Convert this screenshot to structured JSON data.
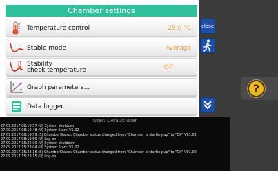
{
  "header": {
    "title": "Chamber settings"
  },
  "menu": [
    {
      "label": "Temperature control",
      "value": "25.0 °C"
    },
    {
      "label": "Stable mode",
      "value": "Average"
    },
    {
      "label_line1": "Stability",
      "label_line2": "check temperature",
      "value": "Off"
    },
    {
      "label": "Graph parameters..."
    },
    {
      "label": "Data logger..."
    }
  ],
  "side": {
    "close_label": "close"
  },
  "log": {
    "title": "User: Default user",
    "lines": [
      "27.09.2017 08:18:57 (U) System shutdown",
      "27.09.2017 08:19:48 (U) System Start: V1.02",
      "27.09.2017 08:19:59 (S) ChamberStatus: Chamber status changed from \"Chamber is starting up\" to \"Ok\" V01.02",
      "27.09.2017 08:19:59 (U) Log-on",
      "27.09.2017 15:22:00 (U) System shutdown",
      "27.09.2017 15:23:04 (U) System Start: V1.02",
      "27.09.2017 15:23:15 (S) ChamberStatus: Chamber status changed from \"Chamber is starting up\" to \"Ok\" V01.02",
      "27.09.2017 15:23:15 (U) Log-on"
    ]
  },
  "help": {
    "symbol": "?"
  },
  "colors": {
    "accent": "#2fc09c",
    "value": "#e8a03a",
    "side_button": "#1d4fa8",
    "help": "#f1b716"
  }
}
